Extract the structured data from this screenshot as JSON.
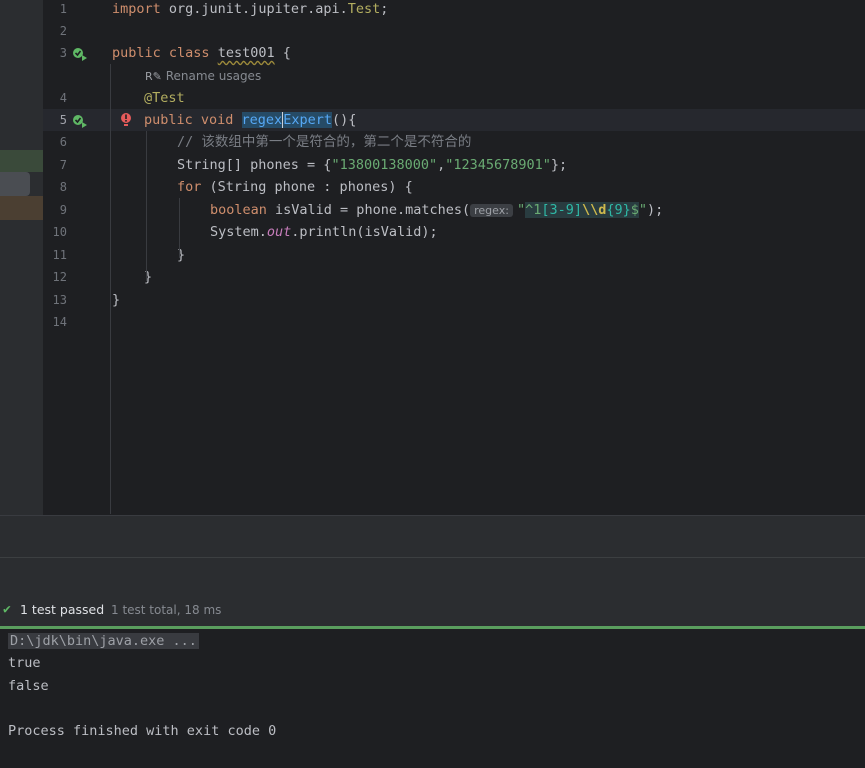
{
  "editor": {
    "lines": [
      {
        "num": "1"
      },
      {
        "num": "2"
      },
      {
        "num": "3"
      },
      {
        "num": "4"
      },
      {
        "num": "5"
      },
      {
        "num": "6"
      },
      {
        "num": "7"
      },
      {
        "num": "8"
      },
      {
        "num": "9"
      },
      {
        "num": "10"
      },
      {
        "num": "11"
      },
      {
        "num": "12"
      },
      {
        "num": "13"
      },
      {
        "num": "14"
      }
    ],
    "import_kw": "import",
    "import_pkg": " org.junit.jupiter.api.",
    "import_cls": "Test",
    "import_end": ";",
    "class_kw": "public class",
    "class_name": "test001",
    "class_open": " {",
    "rename_hint": "Rename usages",
    "annotation": "@Test",
    "method_kw": "public void",
    "method_name_a": "regex",
    "method_name_b": "Expert",
    "method_end": "(){",
    "comment": "// 该数组中第一个是符合的，第二个是不符合的",
    "arr_type": "String[] phones = {",
    "arr_s1": "\"13800138000\"",
    "arr_comma": ",",
    "arr_s2": "\"12345678901\"",
    "arr_end": "};",
    "for_kw": "for",
    "for_rest": " (String phone : phones) {",
    "bool_kw": "boolean",
    "bool_rest": " isValid = phone.matches(",
    "regex_hint": "regex:",
    "regex_q1": "\"",
    "regex_caret": "^1",
    "regex_class": "[3-9]",
    "regex_esc": "\\\\d",
    "regex_quant": "{9}",
    "regex_dollar": "$",
    "regex_q2": "\"",
    "regex_end": ");",
    "sys_a": "System.",
    "sys_out": "out",
    "sys_b": ".println(isValid);",
    "close_inner": "}",
    "close_method": "}",
    "close_class": "}"
  },
  "test_results": {
    "status": "1 test passed",
    "summary": "1 test total, 18 ms"
  },
  "console": {
    "command": "D:\\jdk\\bin\\java.exe ...",
    "out1": "true",
    "out2": "false",
    "finish": "Process finished with exit code 0"
  },
  "colors": {
    "pass_green": "#5fb865",
    "error_red": "#e55b5b",
    "keyword": "#cf8e6d",
    "string": "#6aab73"
  }
}
